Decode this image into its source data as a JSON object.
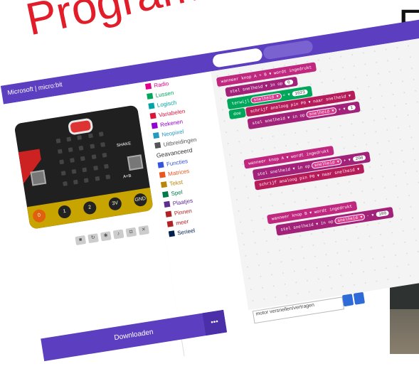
{
  "slide": {
    "title": "Programm",
    "letter": "E"
  },
  "app": {
    "brand": "Microsoft | micro:bit"
  },
  "board": {
    "shake_label": "SHAKE",
    "ab_label": "A+B",
    "pins": [
      "0",
      "1",
      "2",
      "3V",
      "GND"
    ]
  },
  "toolbox": {
    "categories": [
      {
        "label": "Radio",
        "icon": "signal-icon",
        "color": "#e3008c"
      },
      {
        "label": "Lussen",
        "icon": "loop-icon",
        "color": "#00a65a"
      },
      {
        "label": "Logisch",
        "icon": "shuffle-icon",
        "color": "#00a4a6"
      },
      {
        "label": "Variabelen",
        "icon": "variable-icon",
        "color": "#dc143c"
      },
      {
        "label": "Rekenen",
        "icon": "calculator-icon",
        "color": "#9400d3"
      },
      {
        "label": "Neopixel",
        "icon": "sparkle-icon",
        "color": "#2699bf"
      },
      {
        "label": "Uitbreidingen",
        "icon": "plus-circle-icon",
        "color": "#555555"
      }
    ],
    "advanced_label": "Geavanceerd",
    "advanced": [
      {
        "label": "Functies",
        "icon": "function-icon",
        "color": "#3455db"
      },
      {
        "label": "Matrices",
        "icon": "list-icon",
        "color": "#e65722"
      },
      {
        "label": "Tekst",
        "icon": "text-icon",
        "color": "#b8860b"
      },
      {
        "label": "Spel",
        "icon": "gamepad-icon",
        "color": "#007a4b"
      },
      {
        "label": "Plaatjes",
        "icon": "image-icon",
        "color": "#5c2d91"
      },
      {
        "label": "Pinnen",
        "icon": "pin-icon",
        "color": "#b22222"
      },
      {
        "label": "meer",
        "icon": "dots-icon",
        "color": "#b22222"
      },
      {
        "label": "Serieel",
        "icon": "serial-icon",
        "color": "#002050"
      }
    ]
  },
  "blocks": {
    "b1_event": "wanneer knop  A + B  ▾  wordt ingedrukt",
    "b1_set": "stel  snelheid ▾  in op",
    "b1_val": "0",
    "b1_while": "terwijl",
    "b1_cond_var": "snelheid ▾",
    "b1_cond_op": "< ▾",
    "b1_cond_val": "1023",
    "b1_do": "doe",
    "b1_write": "schrijf analoog pin  P0 ▾  naar  snelheid ▾",
    "b1_change": "stel  snelheid ▾  in op",
    "b1_change_var": "snelheid ▾",
    "b1_change_op": "+ ▾",
    "b1_change_val": "1",
    "b2_event": "wanneer knop  A ▾  wordt ingedrukt",
    "b2_set": "stel  snelheid ▾  in op",
    "b2_var": "snelheid ▾",
    "b2_op": "+ ▾",
    "b2_val": "200",
    "b2_write": "schrijf analoog pin  P0 ▾  naar  snelheid ▾",
    "b3_event": "wanneer knop  B ▾  wordt ingedrukt",
    "b3_set": "stel  snelheid ▾  in op",
    "b3_var": "snelheid ▾",
    "b3_op": "- ▾",
    "b3_val": "100"
  },
  "footer": {
    "download_label": "Downloaden",
    "more_label": "•••",
    "filename": "motor versnellen/vertragen"
  }
}
